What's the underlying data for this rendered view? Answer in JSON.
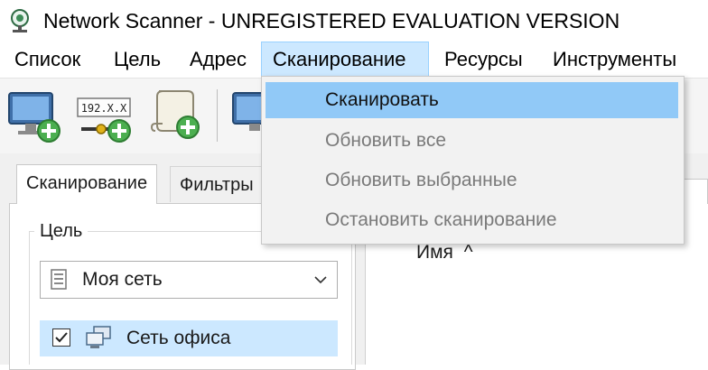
{
  "window": {
    "title": "Network Scanner - UNREGISTERED EVALUATION VERSION",
    "app_icon": "network-scanner-icon"
  },
  "menubar": {
    "items": [
      {
        "label": "Список"
      },
      {
        "label": "Цель"
      },
      {
        "label": "Адрес"
      },
      {
        "label": "Сканирование",
        "active": true
      },
      {
        "label": "Ресурсы"
      },
      {
        "label": "Инструменты"
      }
    ]
  },
  "toolbar": {
    "buttons": [
      {
        "icon": "add-computer-icon"
      },
      {
        "icon": "add-ip-address-icon",
        "text": "192.X.X"
      },
      {
        "icon": "add-script-icon"
      },
      {
        "icon": "computer-icon"
      }
    ]
  },
  "dropdown": {
    "items": [
      {
        "label": "Сканировать",
        "state": "highlighted"
      },
      {
        "label": "Обновить все",
        "state": "disabled"
      },
      {
        "label": "Обновить выбранные",
        "state": "disabled"
      },
      {
        "label": "Остановить сканирование",
        "state": "disabled"
      }
    ]
  },
  "left_pane": {
    "tabs": [
      {
        "label": "Сканирование",
        "selected": true
      },
      {
        "label": "Фильтры",
        "selected": false
      }
    ],
    "group_label": "Цель",
    "combo": {
      "value": "Моя сеть",
      "icon": "document-list-icon"
    },
    "list": [
      {
        "label": "Сеть офиса",
        "checked": true,
        "icon": "network-computers-icon"
      }
    ]
  },
  "right_pane": {
    "column_header": "Имя",
    "sort_indicator": "^"
  },
  "colors": {
    "menu_active_bg": "#cce8ff",
    "dropdown_highlight": "#91c9f7",
    "disabled_text": "#7a7a7a"
  }
}
